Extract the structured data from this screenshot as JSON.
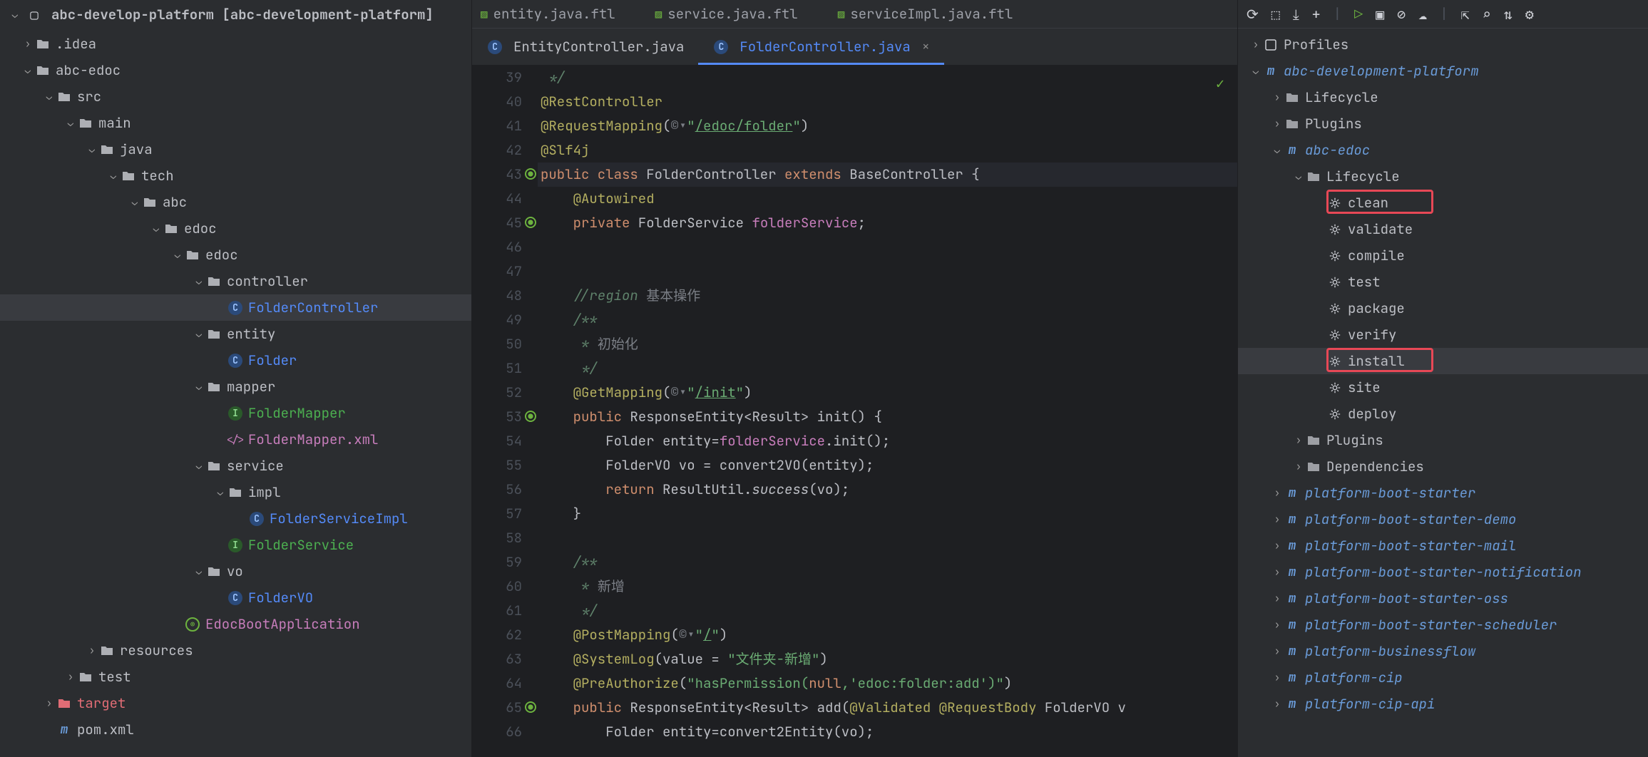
{
  "project": {
    "header": "abc-develop-platform [abc-development-platform]",
    "tree": [
      {
        "depth": 0,
        "chev": ">",
        "icon": "folder",
        "label": ".idea",
        "sel": false
      },
      {
        "depth": 0,
        "chev": "v",
        "icon": "folder-module",
        "label": "abc-edoc",
        "sel": false,
        "bold": true
      },
      {
        "depth": 1,
        "chev": "v",
        "icon": "folder",
        "label": "src",
        "sel": false
      },
      {
        "depth": 2,
        "chev": "v",
        "icon": "folder",
        "label": "main",
        "sel": false
      },
      {
        "depth": 3,
        "chev": "v",
        "icon": "folder-src",
        "label": "java",
        "sel": false
      },
      {
        "depth": 4,
        "chev": "v",
        "icon": "folder",
        "label": "tech",
        "sel": false
      },
      {
        "depth": 5,
        "chev": "v",
        "icon": "folder",
        "label": "abc",
        "sel": false
      },
      {
        "depth": 6,
        "chev": "v",
        "icon": "folder",
        "label": "edoc",
        "sel": false
      },
      {
        "depth": 7,
        "chev": "v",
        "icon": "folder",
        "label": "edoc",
        "sel": false
      },
      {
        "depth": 8,
        "chev": "v",
        "icon": "folder",
        "label": "controller",
        "sel": false
      },
      {
        "depth": 9,
        "chev": "",
        "icon": "c",
        "label": "FolderController",
        "sel": true,
        "cls": "c"
      },
      {
        "depth": 8,
        "chev": "v",
        "icon": "folder",
        "label": "entity",
        "sel": false
      },
      {
        "depth": 9,
        "chev": "",
        "icon": "c",
        "label": "Folder",
        "sel": false,
        "cls": "c"
      },
      {
        "depth": 8,
        "chev": "v",
        "icon": "folder",
        "label": "mapper",
        "sel": false
      },
      {
        "depth": 9,
        "chev": "",
        "icon": "i",
        "label": "FolderMapper",
        "sel": false,
        "cls": "i"
      },
      {
        "depth": 9,
        "chev": "",
        "icon": "xml",
        "label": "FolderMapper.xml",
        "sel": false,
        "cls": "xml"
      },
      {
        "depth": 8,
        "chev": "v",
        "icon": "folder",
        "label": "service",
        "sel": false
      },
      {
        "depth": 9,
        "chev": "v",
        "icon": "folder",
        "label": "impl",
        "sel": false
      },
      {
        "depth": 10,
        "chev": "",
        "icon": "c",
        "label": "FolderServiceImpl",
        "sel": false,
        "cls": "c"
      },
      {
        "depth": 9,
        "chev": "",
        "icon": "i",
        "label": "FolderService",
        "sel": false,
        "cls": "i"
      },
      {
        "depth": 8,
        "chev": "v",
        "icon": "folder",
        "label": "vo",
        "sel": false
      },
      {
        "depth": 9,
        "chev": "",
        "icon": "c",
        "label": "FolderVO",
        "sel": false,
        "cls": "c"
      },
      {
        "depth": 7,
        "chev": "",
        "icon": "spring",
        "label": "EdocBootApplication",
        "sel": false,
        "cls": "spring"
      },
      {
        "depth": 3,
        "chev": ">",
        "icon": "folder",
        "label": "resources",
        "sel": false
      },
      {
        "depth": 2,
        "chev": ">",
        "icon": "folder",
        "label": "test",
        "sel": false
      },
      {
        "depth": 1,
        "chev": ">",
        "icon": "folder-orange",
        "label": "target",
        "sel": false,
        "cls": "orange"
      },
      {
        "depth": 1,
        "chev": "",
        "icon": "m",
        "label": "pom.xml",
        "sel": false,
        "cls": "m"
      }
    ]
  },
  "ftlTabs": [
    "entity.java.ftl",
    "service.java.ftl",
    "serviceImpl.java.ftl"
  ],
  "editorTabs": [
    {
      "icon": "c",
      "label": "EntityController.java",
      "active": false
    },
    {
      "icon": "c",
      "label": "FolderController.java",
      "active": true,
      "close": true
    }
  ],
  "code": {
    "start": 39,
    "lines": [
      {
        "n": 39,
        "html": " <span class='comment'>*/</span>"
      },
      {
        "n": 40,
        "html": "<span class='anno'>@RestController</span>"
      },
      {
        "n": 41,
        "html": "<span class='anno'>@RequestMapping</span>(<span class='comment-cjk'>©▾</span><span class='str'>\"</span><span class='str-link'>/edoc/folder</span><span class='str'>\"</span>)"
      },
      {
        "n": 42,
        "html": "<span class='anno'>@Slf4j</span>"
      },
      {
        "n": 43,
        "html": "<span class='kw'>public class </span><span class='type'>FolderController</span> <span class='kw'>extends</span> <span class='type'>BaseController</span> {",
        "current": true,
        "mark": "green"
      },
      {
        "n": 44,
        "html": "    <span class='anno'>@Autowired</span>"
      },
      {
        "n": 45,
        "html": "    <span class='kw'>private</span> <span class='type'>FolderService</span> <span class='field'>folderService</span>;",
        "mark": "green"
      },
      {
        "n": 46,
        "html": ""
      },
      {
        "n": 47,
        "html": ""
      },
      {
        "n": 48,
        "html": "    <span class='comment'>//region</span> <span class='comment-cjk'>基本操作</span>"
      },
      {
        "n": 49,
        "html": "    <span class='comment'>/**</span>"
      },
      {
        "n": 50,
        "html": "     <span class='comment'>*</span> <span class='comment-cjk'>初始化</span>"
      },
      {
        "n": 51,
        "html": "     <span class='comment'>*/</span>"
      },
      {
        "n": 52,
        "html": "    <span class='anno'>@GetMapping</span>(<span class='comment-cjk'>©▾</span><span class='str'>\"</span><span class='str-link'>/init</span><span class='str'>\"</span>)"
      },
      {
        "n": 53,
        "html": "    <span class='kw'>public</span> <span class='type'>ResponseEntity</span>&lt;<span class='type'>Result</span>&gt; <span class='method-call'>init</span>() {",
        "mark": "green2"
      },
      {
        "n": 54,
        "html": "        <span class='type'>Folder</span> entity=<span class='field'>folderService</span>.init();"
      },
      {
        "n": 55,
        "html": "        <span class='type'>FolderVO</span> vo = convert2VO(entity);"
      },
      {
        "n": 56,
        "html": "        <span class='kw'>return</span> <span class='type'>ResultUtil</span>.<span class='static-call'>success</span>(vo);"
      },
      {
        "n": 57,
        "html": "    }"
      },
      {
        "n": 58,
        "html": ""
      },
      {
        "n": 59,
        "html": "    <span class='comment'>/**</span>"
      },
      {
        "n": 60,
        "html": "     <span class='comment'>*</span> <span class='comment-cjk'>新增</span>"
      },
      {
        "n": 61,
        "html": "     <span class='comment'>*/</span>"
      },
      {
        "n": 62,
        "html": "    <span class='anno'>@PostMapping</span>(<span class='comment-cjk'>©▾</span><span class='str'>\"</span><span class='str-link'>/</span><span class='str'>\"</span>)"
      },
      {
        "n": 63,
        "html": "    <span class='anno'>@SystemLog</span>(value = <span class='str'>\"文件夹-新增\"</span>)"
      },
      {
        "n": 64,
        "html": "    <span class='anno'>@PreAuthorize</span>(<span class='str'>\"hasPermission(</span><span class='kw'>null</span><span class='str'>,</span><span class='str' style='color:#6aab73'>'edoc:folder:add'</span><span class='str'>)\"</span>)"
      },
      {
        "n": 65,
        "html": "    <span class='kw'>public</span> <span class='type'>ResponseEntity</span>&lt;<span class='type'>Result</span>&gt; add(<span class='anno'>@Validated</span> <span class='anno'>@RequestBody</span> <span class='type'>FolderVO</span> v",
        "mark": "green2"
      },
      {
        "n": 66,
        "html": "        <span class='type'>Folder</span> entity=convert2Entity(vo);"
      }
    ]
  },
  "maven": {
    "toolbar": [
      "reload",
      "generate",
      "download",
      "add",
      "sep",
      "run",
      "exec",
      "skip",
      "offline",
      "sep",
      "collapse",
      "search",
      "profile",
      "settings"
    ],
    "tree": [
      {
        "depth": 0,
        "chev": ">",
        "icon": "profiles",
        "label": "Profiles"
      },
      {
        "depth": 0,
        "chev": "v",
        "icon": "m",
        "label": "abc-development-platform",
        "cls": "ital"
      },
      {
        "depth": 1,
        "chev": ">",
        "icon": "life",
        "label": "Lifecycle"
      },
      {
        "depth": 1,
        "chev": ">",
        "icon": "plugins",
        "label": "Plugins"
      },
      {
        "depth": 1,
        "chev": "v",
        "icon": "m",
        "label": "abc-edoc",
        "cls": "ital"
      },
      {
        "depth": 2,
        "chev": "v",
        "icon": "life",
        "label": "Lifecycle"
      },
      {
        "depth": 3,
        "chev": "",
        "icon": "gear",
        "label": "clean",
        "hl": true
      },
      {
        "depth": 3,
        "chev": "",
        "icon": "gear",
        "label": "validate"
      },
      {
        "depth": 3,
        "chev": "",
        "icon": "gear",
        "label": "compile"
      },
      {
        "depth": 3,
        "chev": "",
        "icon": "gear",
        "label": "test"
      },
      {
        "depth": 3,
        "chev": "",
        "icon": "gear",
        "label": "package"
      },
      {
        "depth": 3,
        "chev": "",
        "icon": "gear",
        "label": "verify"
      },
      {
        "depth": 3,
        "chev": "",
        "icon": "gear",
        "label": "install",
        "sel": true,
        "hl": true
      },
      {
        "depth": 3,
        "chev": "",
        "icon": "gear",
        "label": "site"
      },
      {
        "depth": 3,
        "chev": "",
        "icon": "gear",
        "label": "deploy"
      },
      {
        "depth": 2,
        "chev": ">",
        "icon": "plugins",
        "label": "Plugins"
      },
      {
        "depth": 2,
        "chev": ">",
        "icon": "deps",
        "label": "Dependencies"
      },
      {
        "depth": 1,
        "chev": ">",
        "icon": "m",
        "label": "platform-boot-starter",
        "cls": "ital"
      },
      {
        "depth": 1,
        "chev": ">",
        "icon": "m",
        "label": "platform-boot-starter-demo",
        "cls": "ital"
      },
      {
        "depth": 1,
        "chev": ">",
        "icon": "m",
        "label": "platform-boot-starter-mail",
        "cls": "ital"
      },
      {
        "depth": 1,
        "chev": ">",
        "icon": "m",
        "label": "platform-boot-starter-notification",
        "cls": "ital"
      },
      {
        "depth": 1,
        "chev": ">",
        "icon": "m",
        "label": "platform-boot-starter-oss",
        "cls": "ital"
      },
      {
        "depth": 1,
        "chev": ">",
        "icon": "m",
        "label": "platform-boot-starter-scheduler",
        "cls": "ital"
      },
      {
        "depth": 1,
        "chev": ">",
        "icon": "m",
        "label": "platform-businessflow",
        "cls": "ital"
      },
      {
        "depth": 1,
        "chev": ">",
        "icon": "m",
        "label": "platform-cip",
        "cls": "ital"
      },
      {
        "depth": 1,
        "chev": ">",
        "icon": "m",
        "label": "platform-cip-api",
        "cls": "ital"
      }
    ]
  }
}
